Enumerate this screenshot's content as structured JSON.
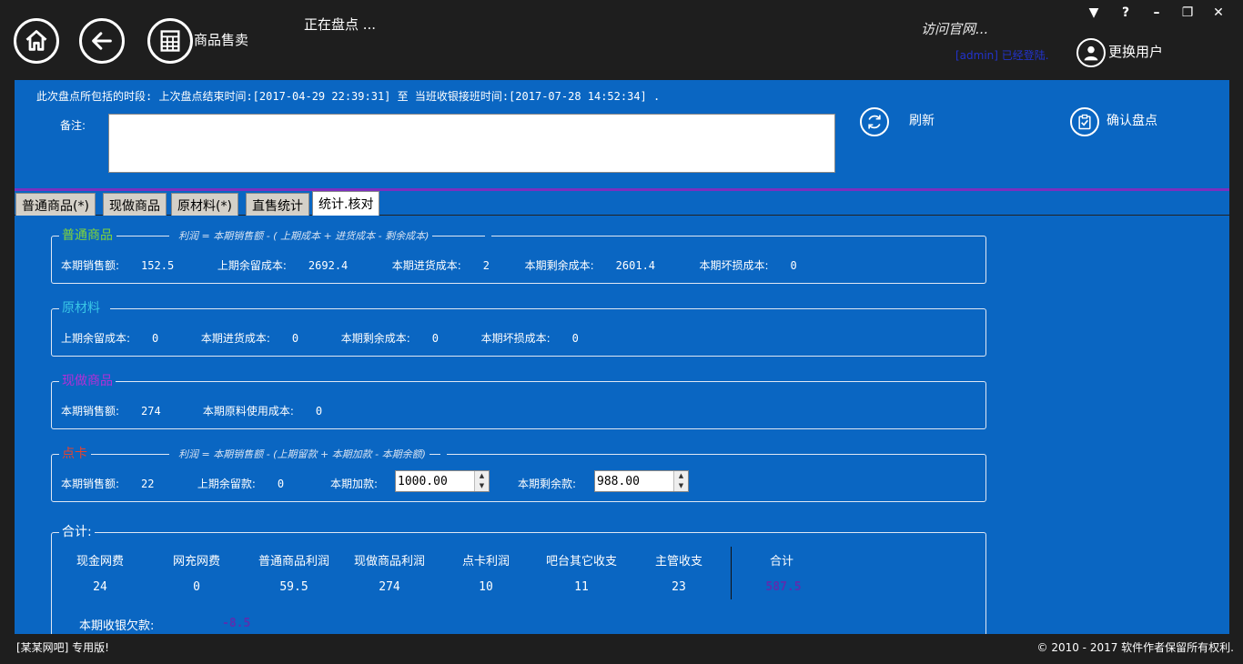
{
  "header": {
    "module_label": "商品售卖",
    "status": "正在盘点 ...",
    "visit_site": "访问官网...",
    "login_info": "[admin] 已经登陆.",
    "switch_user": "更换用户",
    "window_controls": [
      "▼",
      "?",
      "–",
      "❐",
      "✕"
    ]
  },
  "panel": {
    "period": "此次盘点所包括的时段: 上次盘点结束时间:[2017-04-29 22:39:31] 至 当班收银接班时间:[2017-07-28 14:52:34] .",
    "note_label": "备注:",
    "note_value": "",
    "refresh_label": "刷新",
    "confirm_label": "确认盘点"
  },
  "tabs": [
    "普通商品(*)",
    "现做商品",
    "原材料(*)",
    "直售统计",
    "统计.核对"
  ],
  "groups": {
    "normal": {
      "title": "普通商品",
      "title_color": "#7fd43a",
      "formula": "利润 = 本期销售额 - ( 上期成本 + 进货成本 - 剩余成本)",
      "fields": [
        {
          "label": "本期销售额:",
          "value": "152.5"
        },
        {
          "label": "上期余留成本:",
          "value": "2692.4"
        },
        {
          "label": "本期进货成本:",
          "value": "2"
        },
        {
          "label": "本期剩余成本:",
          "value": "2601.4"
        },
        {
          "label": "本期坏损成本:",
          "value": "0"
        }
      ]
    },
    "raw": {
      "title": "原材料",
      "title_color": "#39c6e6",
      "fields": [
        {
          "label": "上期余留成本:",
          "value": "0"
        },
        {
          "label": "本期进货成本:",
          "value": "0"
        },
        {
          "label": "本期剩余成本:",
          "value": "0"
        },
        {
          "label": "本期坏损成本:",
          "value": "0"
        }
      ]
    },
    "made": {
      "title": "现做商品",
      "title_color": "#b32fd6",
      "fields": [
        {
          "label": "本期销售额:",
          "value": "274"
        },
        {
          "label": "本期原料使用成本:",
          "value": "0"
        }
      ]
    },
    "card": {
      "title": "点卡",
      "title_color": "#e8432d",
      "formula": "利润 = 本期销售额 - (上期留款 + 本期加款 - 本期余额)",
      "sales_label": "本期销售额:",
      "sales_value": "22",
      "prev_label": "上期余留款:",
      "prev_value": "0",
      "add_label": "本期加款:",
      "add_value": "1000.00",
      "remain_label": "本期剩余款:",
      "remain_value": "988.00"
    },
    "summary": {
      "title": "合计:",
      "headers": [
        "现金网费",
        "网充网费",
        "普通商品利润",
        "现做商品利润",
        "点卡利润",
        "吧台其它收支",
        "主管收支"
      ],
      "values": [
        "24",
        "0",
        "59.5",
        "274",
        "10",
        "11",
        "23"
      ],
      "total_label": "合计",
      "total_value": "587.5",
      "total_color": "#5a2fb0",
      "debt_label": "本期收银欠款:",
      "debt_value": "-8.5"
    }
  },
  "footer": {
    "left": "[某某网吧] 专用版!",
    "right": "© 2010 - 2017 软件作者保留所有权利."
  }
}
